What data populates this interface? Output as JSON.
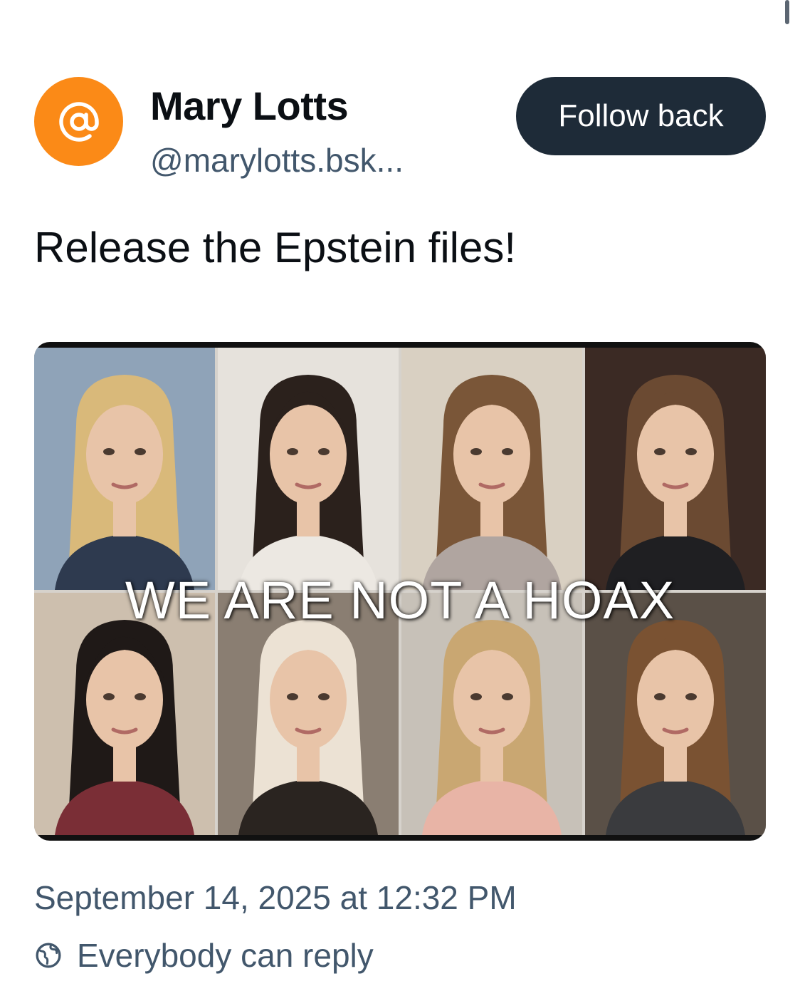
{
  "author": {
    "avatar_icon": "at-sign-icon",
    "avatar_color": "#fb8a17",
    "display_name": "Mary Lotts",
    "handle": "@marylotts.bsk..."
  },
  "follow_button": {
    "label": "Follow back",
    "background": "#1e2b38"
  },
  "post": {
    "text": "Release the Epstein files!",
    "image": {
      "overlay_text": "WE ARE NOT A HOAX",
      "panels": [
        {
          "hair_color": "#d9b97a",
          "bg_color": "#8fa3b8",
          "top_color": "#2e3a4f"
        },
        {
          "hair_color": "#2b211c",
          "bg_color": "#e6e2dc",
          "top_color": "#ece8e2"
        },
        {
          "hair_color": "#7a5638",
          "bg_color": "#d9d0c2",
          "top_color": "#b0a5a0"
        },
        {
          "hair_color": "#6b4a32",
          "bg_color": "#3b2a24",
          "top_color": "#1f1f22"
        },
        {
          "hair_color": "#1f1917",
          "bg_color": "#cdbfae",
          "top_color": "#7a2e36"
        },
        {
          "hair_color": "#ece2d4",
          "bg_color": "#8a7e72",
          "top_color": "#2a2420"
        },
        {
          "hair_color": "#c9a772",
          "bg_color": "#c7c1b8",
          "top_color": "#e8b4a6"
        },
        {
          "hair_color": "#7a5232",
          "bg_color": "#5a5047",
          "top_color": "#3a3b3e"
        }
      ]
    }
  },
  "meta": {
    "timestamp": "September 14, 2025 at 12:32 PM",
    "reply_icon": "globe-icon",
    "reply_setting": "Everybody can reply"
  }
}
